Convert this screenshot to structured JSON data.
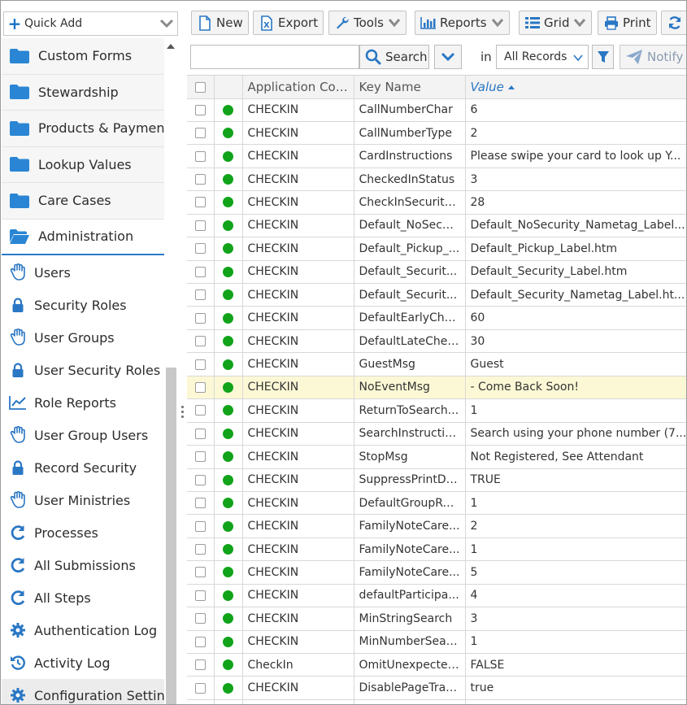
{
  "sidebar": {
    "quick_add_label": "Quick Add",
    "folders": [
      {
        "label": "Custom Forms",
        "icon": "folder-icon"
      },
      {
        "label": "Stewardship",
        "icon": "folder-icon"
      },
      {
        "label": "Products & Payments",
        "icon": "folder-icon"
      },
      {
        "label": "Lookup Values",
        "icon": "folder-icon"
      },
      {
        "label": "Care Cases",
        "icon": "folder-icon"
      },
      {
        "label": "Administration",
        "icon": "folder-open-icon"
      }
    ],
    "items": [
      {
        "label": "Users",
        "icon": "hand-icon"
      },
      {
        "label": "Security Roles",
        "icon": "lock-icon"
      },
      {
        "label": "User Groups",
        "icon": "hand-icon"
      },
      {
        "label": "User Security Roles",
        "icon": "lock-icon"
      },
      {
        "label": "Role Reports",
        "icon": "chart-line-icon"
      },
      {
        "label": "User Group Users",
        "icon": "hand-icon"
      },
      {
        "label": "Record Security",
        "icon": "lock-icon"
      },
      {
        "label": "User Ministries",
        "icon": "hand-icon"
      },
      {
        "label": "Processes",
        "icon": "refresh-icon"
      },
      {
        "label": "All Submissions",
        "icon": "refresh-icon"
      },
      {
        "label": "All Steps",
        "icon": "refresh-icon"
      },
      {
        "label": "Authentication Log",
        "icon": "gear-icon"
      },
      {
        "label": "Activity Log",
        "icon": "history-icon"
      },
      {
        "label": "Configuration Settings",
        "icon": "gear-icon"
      }
    ]
  },
  "toolbar": {
    "new_label": "New",
    "export_label": "Export",
    "tools_label": "Tools",
    "reports_label": "Reports",
    "grid_label": "Grid",
    "print_label": "Print"
  },
  "search": {
    "value": "",
    "placeholder": "",
    "button_label": "Search",
    "in_label": "in",
    "view_selected": "All Records",
    "notify_label": "Notify"
  },
  "colors": {
    "accent": "#2a77c4",
    "status_active": "#11a31a",
    "highlight_row": "#fcf8d5"
  },
  "grid": {
    "columns": [
      "Application Code",
      "Key Name",
      "Value"
    ],
    "sorted_column": "Value",
    "rows": [
      {
        "app": "CHECKIN",
        "key": "CallNumberChar",
        "value": "6"
      },
      {
        "app": "CHECKIN",
        "key": "CallNumberType",
        "value": "2"
      },
      {
        "app": "CHECKIN",
        "key": "CardInstructions",
        "value": "Please swipe your card to look up Y..."
      },
      {
        "app": "CHECKIN",
        "key": "CheckedInStatus",
        "value": "3"
      },
      {
        "app": "CHECKIN",
        "key": "CheckInSecurity...",
        "value": "28"
      },
      {
        "app": "CHECKIN",
        "key": "Default_NoSecu...",
        "value": "Default_NoSecurity_Nametag_Label..."
      },
      {
        "app": "CHECKIN",
        "key": "Default_Pickup_...",
        "value": "Default_Pickup_Label.htm"
      },
      {
        "app": "CHECKIN",
        "key": "Default_Securit...",
        "value": "Default_Security_Label.htm"
      },
      {
        "app": "CHECKIN",
        "key": "Default_Securit...",
        "value": "Default_Security_Nametag_Label.ht..."
      },
      {
        "app": "CHECKIN",
        "key": "DefaultEarlyChe...",
        "value": "60"
      },
      {
        "app": "CHECKIN",
        "key": "DefaultLateChec...",
        "value": "30"
      },
      {
        "app": "CHECKIN",
        "key": "GuestMsg",
        "value": "Guest"
      },
      {
        "app": "CHECKIN",
        "key": "NoEventMsg",
        "value": "- Come Back Soon!"
      },
      {
        "app": "CHECKIN",
        "key": "ReturnToSearch...",
        "value": "1"
      },
      {
        "app": "CHECKIN",
        "key": "SearchInstructio...",
        "value": "Search using your phone number (7..."
      },
      {
        "app": "CHECKIN",
        "key": "StopMsg",
        "value": "Not Registered, See Attendant"
      },
      {
        "app": "CHECKIN",
        "key": "SuppressPrintDi...",
        "value": "TRUE"
      },
      {
        "app": "CHECKIN",
        "key": "DefaultGroupRol...",
        "value": "1"
      },
      {
        "app": "CHECKIN",
        "key": "FamilyNoteCare...",
        "value": "2"
      },
      {
        "app": "CHECKIN",
        "key": "FamilyNoteCare...",
        "value": "1"
      },
      {
        "app": "CHECKIN",
        "key": "FamilyNoteCare...",
        "value": "5"
      },
      {
        "app": "CHECKIN",
        "key": "defaultParticipa...",
        "value": "4"
      },
      {
        "app": "CHECKIN",
        "key": "MinStringSearch",
        "value": "3"
      },
      {
        "app": "CHECKIN",
        "key": "MinNumberSear...",
        "value": "1"
      },
      {
        "app": "CheckIn",
        "key": "OmitUnexpected...",
        "value": "FALSE"
      },
      {
        "app": "CHECKIN",
        "key": "DisablePageTran...",
        "value": "true"
      },
      {
        "app": "",
        "key": "",
        "value": ""
      }
    ]
  }
}
